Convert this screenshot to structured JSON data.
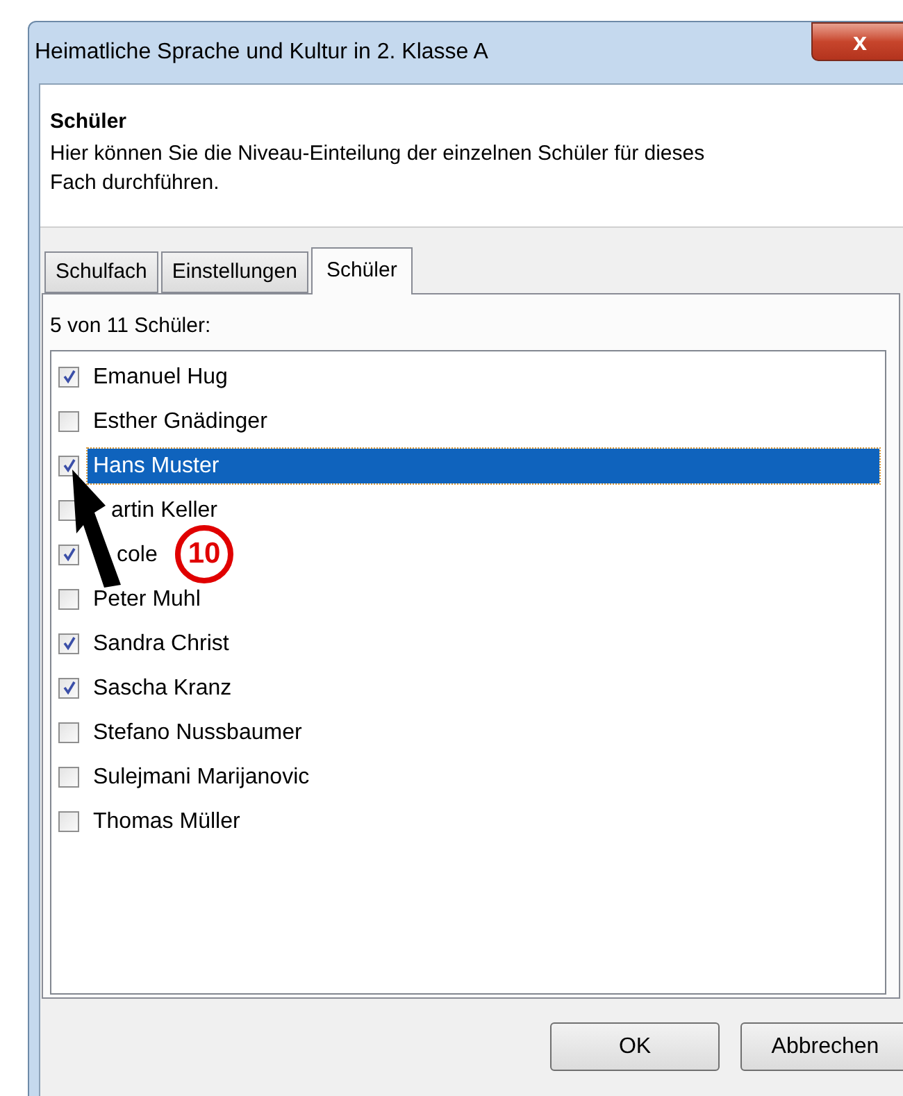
{
  "window": {
    "title": "Heimatliche Sprache und Kultur in 2. Klasse A",
    "close_glyph": "x"
  },
  "header": {
    "title": "Schüler",
    "description": "Hier können Sie die Niveau-Einteilung der einzelnen Schüler für dieses Fach durchführen."
  },
  "tabs": [
    {
      "label": "Schulfach",
      "selected": false
    },
    {
      "label": "Einstellungen",
      "selected": false
    },
    {
      "label": "Schüler",
      "selected": true
    }
  ],
  "count_label": "5 von 11 Schüler:",
  "students": [
    {
      "name": "Emanuel Hug",
      "checked": true,
      "selected": false
    },
    {
      "name": "Esther Gnädinger",
      "checked": false,
      "selected": false
    },
    {
      "name": "Hans Muster",
      "checked": true,
      "selected": true
    },
    {
      "name": "artin Keller",
      "checked": false,
      "selected": false
    },
    {
      "name": "cole",
      "checked": true,
      "selected": false
    },
    {
      "name": "Peter Muhl",
      "checked": false,
      "selected": false
    },
    {
      "name": "Sandra Christ",
      "checked": true,
      "selected": false
    },
    {
      "name": "Sascha Kranz",
      "checked": true,
      "selected": false
    },
    {
      "name": "Stefano Nussbaumer",
      "checked": false,
      "selected": false
    },
    {
      "name": "Sulejmani Marijanovic",
      "checked": false,
      "selected": false
    },
    {
      "name": "Thomas Müller",
      "checked": false,
      "selected": false
    }
  ],
  "callout": {
    "number": "10"
  },
  "buttons": [
    "OK",
    "Abbrechen"
  ]
}
